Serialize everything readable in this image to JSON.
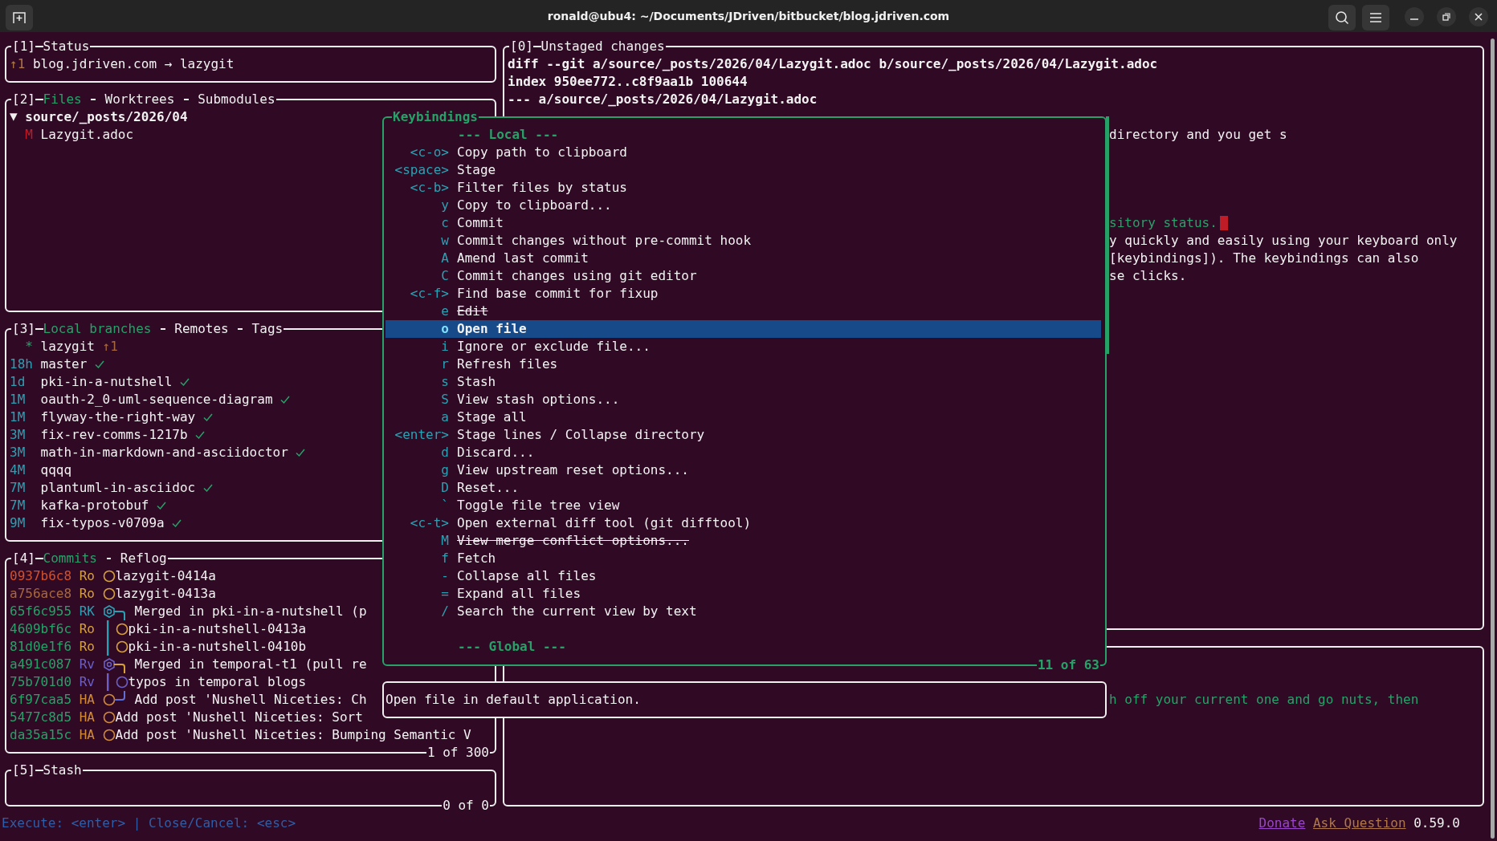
{
  "window": {
    "title": "ronald@ubu4: ~/Documents/JDriven/bitbucket/blog.jdriven.com"
  },
  "left_panels": [
    {
      "kind": "status",
      "number": "[1]",
      "tabs": [
        {
          "label": "Status",
          "selected": false
        }
      ],
      "ahead": "↑1",
      "text": "blog.jdriven.com → lazygit"
    },
    {
      "kind": "files",
      "number": "[2]",
      "tabs": [
        {
          "label": "Files",
          "selected": true
        },
        {
          "label": "Worktrees",
          "selected": false
        },
        {
          "label": "Submodules",
          "selected": false
        }
      ],
      "tree": [
        {
          "name": "source/_posts/2026/04",
          "expanded": true,
          "children": [
            {
              "status": "M",
              "name": "Lazygit.adoc"
            }
          ]
        }
      ]
    },
    {
      "kind": "branches",
      "number": "[3]",
      "tabs": [
        {
          "label": "Local branches",
          "selected": true
        },
        {
          "label": "Remotes",
          "selected": false
        },
        {
          "label": "Tags",
          "selected": false
        }
      ],
      "branches": [
        {
          "marker": "*",
          "name": "lazygit",
          "ahead": "↑1",
          "pushed": false
        },
        {
          "age": "18h",
          "name": "master",
          "pushed": true
        },
        {
          "age": "1d",
          "name": "pki-in-a-nutshell",
          "pushed": true
        },
        {
          "age": "1M",
          "name": "oauth-2_0-uml-sequence-diagram",
          "pushed": true
        },
        {
          "age": "1M",
          "name": "flyway-the-right-way",
          "pushed": true
        },
        {
          "age": "3M",
          "name": "fix-rev-comms-1217b",
          "pushed": true
        },
        {
          "age": "3M",
          "name": "math-in-markdown-and-asciidoctor",
          "pushed": true
        },
        {
          "age": "4M",
          "name": "qqqq",
          "pushed": false
        },
        {
          "age": "7M",
          "name": "plantuml-in-asciidoc",
          "pushed": true
        },
        {
          "age": "7M",
          "name": "kafka-protobuf",
          "pushed": true
        },
        {
          "age": "9M",
          "name": "fix-typos-v0709a",
          "pushed": true
        }
      ]
    },
    {
      "kind": "commits",
      "number": "[4]",
      "tabs": [
        {
          "label": "Commits",
          "selected": true
        },
        {
          "label": "Reflog",
          "selected": false
        }
      ],
      "footer": "1 of 300",
      "commits": [
        {
          "hash": "0937b6c8",
          "pushed": false,
          "merged": false,
          "author": "Ro",
          "color": "#d7a13a",
          "graph": {
            "kind": "node",
            "color": "#d7a13a"
          },
          "message": "lazygit-0414a"
        },
        {
          "hash": "a756ace8",
          "pushed": true,
          "merged": false,
          "author": "Ro",
          "color": "#d7a13a",
          "graph": {
            "kind": "node",
            "color": "#d7a13a"
          },
          "message": "lazygit-0413a"
        },
        {
          "hash": "65f6c955",
          "merged": true,
          "author": "RK",
          "color": "#2aa1b3",
          "graph": {
            "kind": "merge",
            "color": "#2aa1b3"
          },
          "message": "Merged in pki-in-a-nutshell (p"
        },
        {
          "hash": "4609bf6c",
          "merged": true,
          "author": "Ro",
          "color": "#d7a13a",
          "graph": {
            "kind": "side",
            "color": "#2aa1b3"
          },
          "message": "pki-in-a-nutshell-0413a"
        },
        {
          "hash": "81d0e1f6",
          "merged": true,
          "author": "Ro",
          "color": "#d7a13a",
          "graph": {
            "kind": "side",
            "color": "#2aa1b3"
          },
          "message": "pki-in-a-nutshell-0410b"
        },
        {
          "hash": "a491c087",
          "merged": true,
          "author": "Rv",
          "color": "#6c5fc7",
          "graph": {
            "kind": "merge",
            "color": "#d7a13a"
          },
          "message": "Merged in temporal-t1 (pull re"
        },
        {
          "hash": "75b701d0",
          "merged": true,
          "author": "Rv",
          "color": "#6c5fc7",
          "graph": {
            "kind": "side",
            "color": "#6c5fc7"
          },
          "message": "typos in temporal blogs"
        },
        {
          "hash": "6f97caa5",
          "merged": true,
          "author": "HA",
          "color": "#d08a3a",
          "graph": {
            "kind": "fork",
            "color": "#5f6fd7"
          },
          "message": "Add post 'Nushell Niceties: Ch"
        },
        {
          "hash": "5477c8d5",
          "merged": true,
          "author": "HA",
          "color": "#d08a3a",
          "graph": {
            "kind": "node",
            "color": "#d08a3a"
          },
          "message": "Add post 'Nushell Niceties: Sort"
        },
        {
          "hash": "da35a15c",
          "merged": true,
          "author": "HA",
          "color": "#d08a3a",
          "graph": {
            "kind": "node",
            "color": "#d08a3a"
          },
          "message": "Add post 'Nushell Niceties: Bumping Semantic V"
        }
      ]
    },
    {
      "kind": "stash",
      "number": "[5]",
      "tabs": [
        {
          "label": "Stash",
          "selected": false
        }
      ],
      "footer": "0 of 0"
    }
  ],
  "right_panels": [
    {
      "kind": "main",
      "number": "[0]",
      "tabs": [
        {
          "label": "Unstaged changes",
          "selected": false
        }
      ],
      "lines": [
        {
          "kind": "header",
          "text": "diff --git a/source/_posts/2026/04/Lazygit.adoc b/source/_posts/2026/04/Lazygit.adoc"
        },
        {
          "kind": "header",
          "text": "index 950ee772..c8f9aa1b 100644"
        },
        {
          "kind": "header",
          "text": "--- a/source/_posts/2026/04/Lazygit.adoc"
        },
        {
          "kind": "plain",
          "text": "directory and you get s",
          "cursor": false
        },
        {
          "kind": "added",
          "text": "sitory status.",
          "cursor": true
        },
        {
          "kind": "plain",
          "text": "y quickly and easily using your keyboard only",
          "cursor": false
        },
        {
          "kind": "plain",
          "text": "[keybindings]). The keybindings can also",
          "cursor": false
        },
        {
          "kind": "plain",
          "text": "se clicks.",
          "cursor": false
        }
      ]
    },
    {
      "kind": "secondary",
      "lines": [
        {
          "kind": "added",
          "text": "h off your current one and go nuts, then",
          "cursor": false
        }
      ]
    }
  ],
  "keybindings": {
    "title": "Keybindings",
    "footer": "11 of 63",
    "items": [
      {
        "kind": "header",
        "label": "--- Local ---"
      },
      {
        "kind": "binding",
        "key": "<c-o>",
        "label": "Copy path to clipboard",
        "selected": false,
        "disabled": false
      },
      {
        "kind": "binding",
        "key": "<space>",
        "label": "Stage",
        "selected": false,
        "disabled": false
      },
      {
        "kind": "binding",
        "key": "<c-b>",
        "label": "Filter files by status",
        "selected": false,
        "disabled": false
      },
      {
        "kind": "binding",
        "key": "y",
        "label": "Copy to clipboard...",
        "selected": false,
        "disabled": false
      },
      {
        "kind": "binding",
        "key": "c",
        "label": "Commit",
        "selected": false,
        "disabled": false
      },
      {
        "kind": "binding",
        "key": "w",
        "label": "Commit changes without pre-commit hook",
        "selected": false,
        "disabled": false
      },
      {
        "kind": "binding",
        "key": "A",
        "label": "Amend last commit",
        "selected": false,
        "disabled": false
      },
      {
        "kind": "binding",
        "key": "C",
        "label": "Commit changes using git editor",
        "selected": false,
        "disabled": false
      },
      {
        "kind": "binding",
        "key": "<c-f>",
        "label": "Find base commit for fixup",
        "selected": false,
        "disabled": false
      },
      {
        "kind": "binding",
        "key": "e",
        "label": "Edit",
        "selected": false,
        "disabled": true
      },
      {
        "kind": "binding",
        "key": "o",
        "label": "Open file",
        "selected": true,
        "disabled": false
      },
      {
        "kind": "binding",
        "key": "i",
        "label": "Ignore or exclude file...",
        "selected": false,
        "disabled": false
      },
      {
        "kind": "binding",
        "key": "r",
        "label": "Refresh files",
        "selected": false,
        "disabled": false
      },
      {
        "kind": "binding",
        "key": "s",
        "label": "Stash",
        "selected": false,
        "disabled": false
      },
      {
        "kind": "binding",
        "key": "S",
        "label": "View stash options...",
        "selected": false,
        "disabled": false
      },
      {
        "kind": "binding",
        "key": "a",
        "label": "Stage all",
        "selected": false,
        "disabled": false
      },
      {
        "kind": "binding",
        "key": "<enter>",
        "label": "Stage lines / Collapse directory",
        "selected": false,
        "disabled": false
      },
      {
        "kind": "binding",
        "key": "d",
        "label": "Discard...",
        "selected": false,
        "disabled": false
      },
      {
        "kind": "binding",
        "key": "g",
        "label": "View upstream reset options...",
        "selected": false,
        "disabled": false
      },
      {
        "kind": "binding",
        "key": "D",
        "label": "Reset...",
        "selected": false,
        "disabled": false
      },
      {
        "kind": "binding",
        "key": "`",
        "label": "Toggle file tree view",
        "selected": false,
        "disabled": false
      },
      {
        "kind": "binding",
        "key": "<c-t>",
        "label": "Open external diff tool (git difftool)",
        "selected": false,
        "disabled": false
      },
      {
        "kind": "binding",
        "key": "M",
        "label": "View merge conflict options...",
        "selected": false,
        "disabled": true
      },
      {
        "kind": "binding",
        "key": "f",
        "label": "Fetch",
        "selected": false,
        "disabled": false
      },
      {
        "kind": "binding",
        "key": "-",
        "label": "Collapse all files",
        "selected": false,
        "disabled": false
      },
      {
        "kind": "binding",
        "key": "=",
        "label": "Expand all files",
        "selected": false,
        "disabled": false
      },
      {
        "kind": "binding",
        "key": "/",
        "label": "Search the current view by text",
        "selected": false,
        "disabled": false
      },
      {
        "kind": "header",
        "label": "--- Global ---"
      }
    ]
  },
  "description": "Open file in default application.",
  "status_bar": {
    "hint": "Execute: <enter> | Close/Cancel: <esc>",
    "links": [
      {
        "kind": "donate",
        "label": "Donate"
      },
      {
        "kind": "ask",
        "label": "Ask Question"
      }
    ],
    "version": "0.59.0"
  }
}
